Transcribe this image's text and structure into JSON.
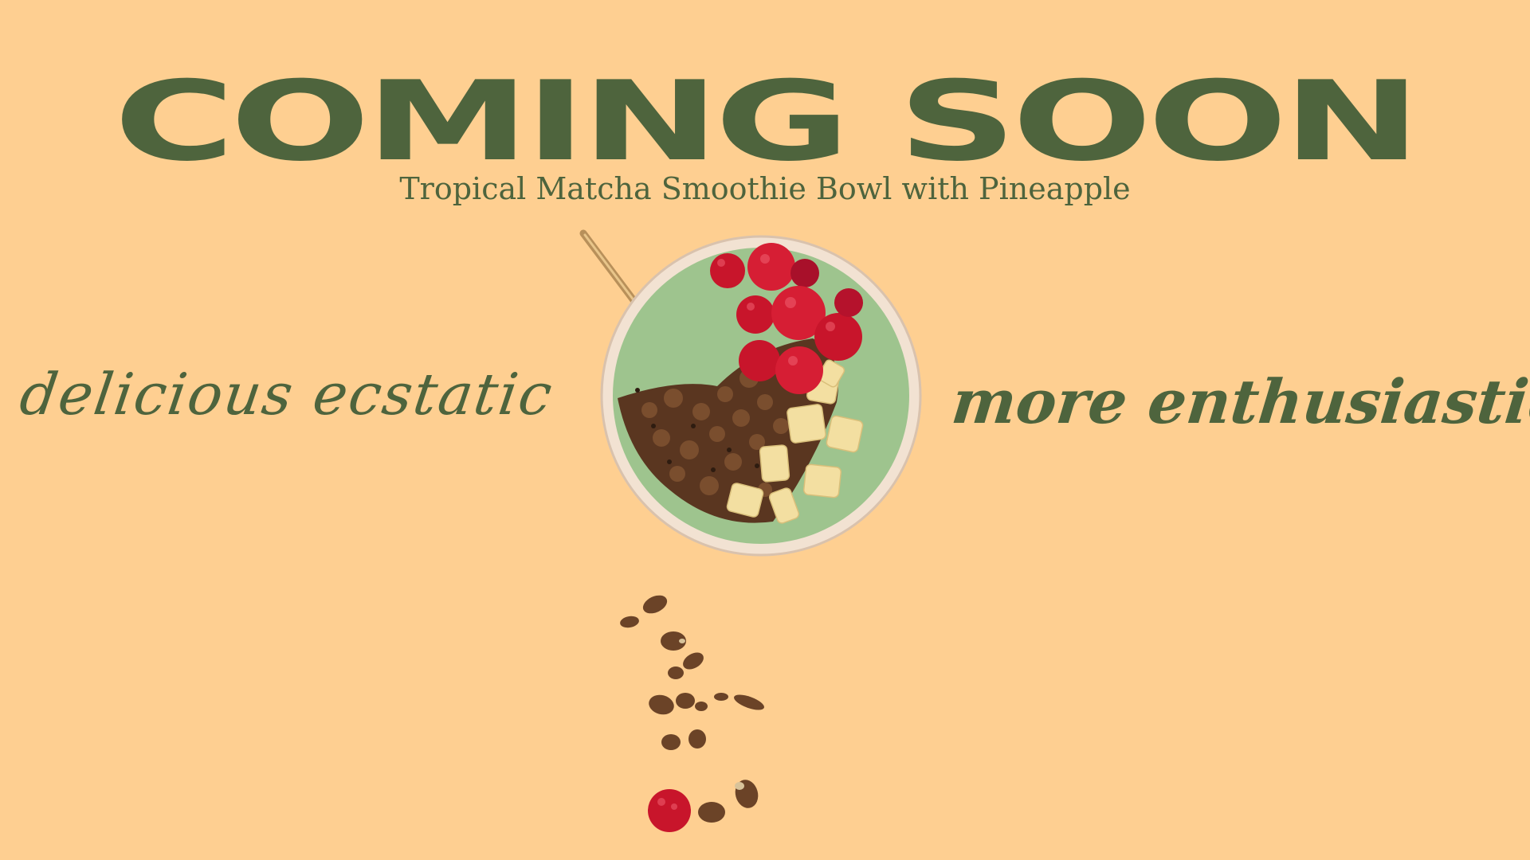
{
  "hero": {
    "headline": "COMING SOON",
    "subtitle": "Tropical Matcha Smoothie Bowl with Pineapple"
  },
  "taglines": {
    "left": "delicious ecstatic",
    "right": "more enthusiastic"
  },
  "colors": {
    "background": "#FECF91",
    "text": "#4E643D",
    "smoothie": "#9EC48E",
    "bowl_rim": "#F2E2D2",
    "raspberry": "#C8152B",
    "granola": "#5A3620",
    "pineapple": "#F3DFA1"
  },
  "icons": {
    "bowl": "smoothie-bowl-icon",
    "crumbs": "granola-crumbs-icon"
  }
}
